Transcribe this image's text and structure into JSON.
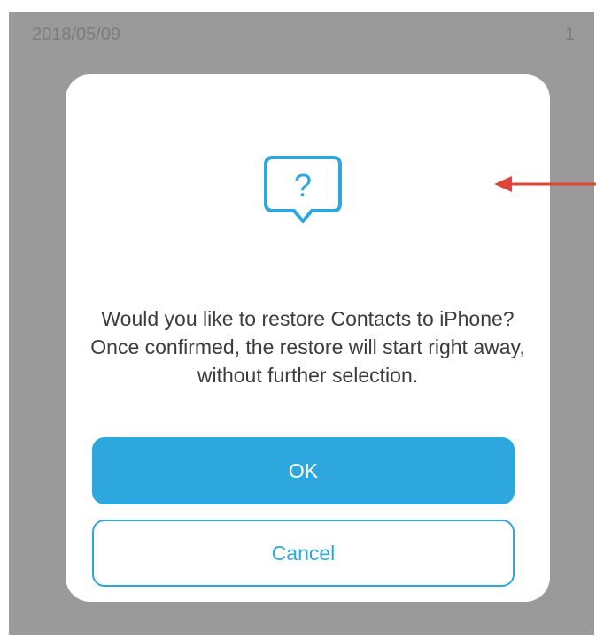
{
  "background": {
    "date": "2018/05/09",
    "count": "1"
  },
  "dialog": {
    "icon": "question-bubble-icon",
    "message": "Would you like to restore Contacts to iPhone? Once confirmed, the restore will start right away, without further selection.",
    "ok_label": "OK",
    "cancel_label": "Cancel"
  },
  "annotation": {
    "arrow": "red-arrow-icon"
  },
  "colors": {
    "accent": "#2ea7df",
    "overlay": "#9a9a9a",
    "arrow": "#e0453c"
  }
}
